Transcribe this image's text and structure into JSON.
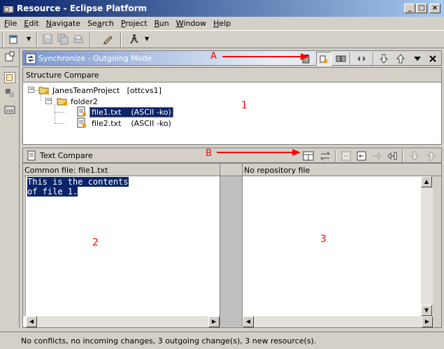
{
  "window": {
    "title": "Resource - Eclipse Platform"
  },
  "menubar": {
    "items": [
      {
        "label": "File",
        "accel": "F"
      },
      {
        "label": "Edit",
        "accel": "E"
      },
      {
        "label": "Navigate",
        "accel": "N"
      },
      {
        "label": "Search",
        "accel": "a"
      },
      {
        "label": "Project",
        "accel": "P"
      },
      {
        "label": "Run",
        "accel": "R"
      },
      {
        "label": "Window",
        "accel": "W"
      },
      {
        "label": "Help",
        "accel": "H"
      }
    ]
  },
  "sync_view": {
    "title": "Synchronize - Outgoing Mode"
  },
  "structure_compare": {
    "label": "Structure Compare",
    "tree": {
      "project": "JanesTeamProject   [ottcvs1]",
      "folder": "folder2",
      "files": [
        {
          "name": "file1.txt",
          "type": "(ASCII -ko)"
        },
        {
          "name": "file2.txt",
          "type": "(ASCII -ko)"
        }
      ]
    }
  },
  "text_compare": {
    "label": "Text Compare",
    "left_header": "Common file: file1.txt",
    "right_header": "No repository file",
    "left_lines": [
      "This is the contents",
      "of file 1."
    ]
  },
  "annotations": {
    "a": "A",
    "b": "B",
    "one": "1",
    "two": "2",
    "three": "3"
  },
  "status": {
    "text": "No conflicts, no incoming changes, 3 outgoing change(s), 3 new resource(s)."
  },
  "colors": {
    "selection": "#0a246a",
    "annotation": "#ff0000",
    "titlebar": "#0a246a"
  }
}
